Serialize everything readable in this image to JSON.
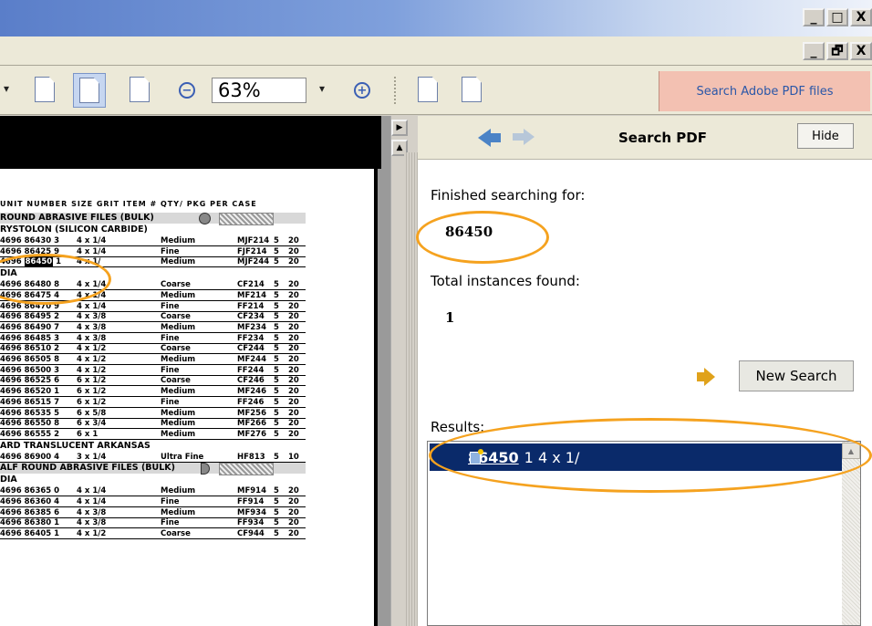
{
  "window": {
    "btn_min": "_",
    "btn_restore": "□",
    "btn_close": "X",
    "btn_min2": "_",
    "btn_restore2": "🗗",
    "btn_close2": "X"
  },
  "toolbar": {
    "zoom_out": "−",
    "zoom_value": "63%",
    "zoom_dropdown": "▾",
    "zoom_in": "+",
    "left_dropdown": "▾",
    "search_adobe_label": "Search Adobe PDF files"
  },
  "splitter": {
    "collapse_arrow": "▶",
    "scroll_up": "▲"
  },
  "search_panel": {
    "title": "Search PDF",
    "hide_label": "Hide",
    "finished_label": "Finished searching for:",
    "search_term": "86450",
    "total_label": "Total instances found:",
    "total_count": "1",
    "new_search_label": "New Search",
    "results_label": "Results:",
    "result": {
      "link": "86450",
      "rest": "1 4 x 1/"
    },
    "scroll_up": "▲"
  },
  "catalog": {
    "header": "UNIT NUMBER       SIZE                     GRIT                 ITEM #   QTY/ PKG  PER CASE",
    "sections": [
      {
        "title": "ROUND ABRASIVE FILES (BULK)",
        "shaded": true
      },
      {
        "title": "RYSTOLON (SILICON CARBIDE)",
        "shaded": false
      },
      {
        "title": "DIA",
        "shaded": false
      },
      {
        "title": "ARD TRANSLUCENT ARKANSAS",
        "shaded": false
      },
      {
        "title": "ALF ROUND ABRASIVE FILES (BULK)",
        "shaded": true
      },
      {
        "title": "DIA",
        "shaded": false
      }
    ],
    "rows_a": [
      {
        "code": "4696 86430 3",
        "size": "4 x 1/4",
        "grit": "Medium",
        "item": "MJF214",
        "q1": "5",
        "q2": "20"
      },
      {
        "code": "4696 86425 9",
        "size": "4 x 1/4",
        "grit": "Fine",
        "item": "FJF214",
        "q1": "5",
        "q2": "20"
      },
      {
        "code_pre": "4696 ",
        "code_hl": "86450",
        "code_post": " 1",
        "size": "4 x 1/",
        "grit": "Medium",
        "item": "MJF244",
        "q1": "5",
        "q2": "20"
      }
    ],
    "rows_b": [
      {
        "code": "4696 86480 8",
        "size": "4 x 1/4",
        "grit": "Coarse",
        "item": "CF214",
        "q1": "5",
        "q2": "20"
      },
      {
        "code": "4696 86475 4",
        "size": "4 x 1/4",
        "grit": "Medium",
        "item": "MF214",
        "q1": "5",
        "q2": "20"
      },
      {
        "code": "4696 86470 9",
        "size": "4 x 1/4",
        "grit": "Fine",
        "item": "FF214",
        "q1": "5",
        "q2": "20"
      },
      {
        "code": "4696 86495 2",
        "size": "4 x 3/8",
        "grit": "Coarse",
        "item": "CF234",
        "q1": "5",
        "q2": "20"
      },
      {
        "code": "4696 86490 7",
        "size": "4 x 3/8",
        "grit": "Medium",
        "item": "MF234",
        "q1": "5",
        "q2": "20"
      },
      {
        "code": "4696 86485 3",
        "size": "4 x 3/8",
        "grit": "Fine",
        "item": "FF234",
        "q1": "5",
        "q2": "20"
      },
      {
        "code": "4696 86510 2",
        "size": "4 x 1/2",
        "grit": "Coarse",
        "item": "CF244",
        "q1": "5",
        "q2": "20"
      },
      {
        "code": "4696 86505 8",
        "size": "4 x 1/2",
        "grit": "Medium",
        "item": "MF244",
        "q1": "5",
        "q2": "20"
      },
      {
        "code": "4696 86500 3",
        "size": "4 x 1/2",
        "grit": "Fine",
        "item": "FF244",
        "q1": "5",
        "q2": "20"
      },
      {
        "code": "4696 86525 6",
        "size": "6 x 1/2",
        "grit": "Coarse",
        "item": "CF246",
        "q1": "5",
        "q2": "20"
      },
      {
        "code": "4696 86520 1",
        "size": "6 x 1/2",
        "grit": "Medium",
        "item": "MF246",
        "q1": "5",
        "q2": "20"
      },
      {
        "code": "4696 86515 7",
        "size": "6 x 1/2",
        "grit": "Fine",
        "item": "FF246",
        "q1": "5",
        "q2": "20"
      },
      {
        "code": "4696 86535 5",
        "size": "6 x 5/8",
        "grit": "Medium",
        "item": "MF256",
        "q1": "5",
        "q2": "20"
      },
      {
        "code": "4696 86550 8",
        "size": "6 x 3/4",
        "grit": "Medium",
        "item": "MF266",
        "q1": "5",
        "q2": "20"
      },
      {
        "code": "4696 86555 2",
        "size": "6 x 1",
        "grit": "Medium",
        "item": "MF276",
        "q1": "5",
        "q2": "20"
      }
    ],
    "rows_c": [
      {
        "code": "4696 86900 4",
        "size": "3 x 1/4",
        "grit": "Ultra Fine",
        "item": "HF813",
        "q1": "5",
        "q2": "10"
      }
    ],
    "rows_d": [
      {
        "code": "4696 86365 0",
        "size": "4 x 1/4",
        "grit": "Medium",
        "item": "MF914",
        "q1": "5",
        "q2": "20"
      },
      {
        "code": "4696 86360 4",
        "size": "4 x 1/4",
        "grit": "Fine",
        "item": "FF914",
        "q1": "5",
        "q2": "20"
      },
      {
        "code": "4696 86385 6",
        "size": "4 x 3/8",
        "grit": "Medium",
        "item": "MF934",
        "q1": "5",
        "q2": "20"
      },
      {
        "code": "4696 86380 1",
        "size": "4 x 3/8",
        "grit": "Fine",
        "item": "FF934",
        "q1": "5",
        "q2": "20"
      },
      {
        "code": "4696 86405 1",
        "size": "4 x 1/2",
        "grit": "Coarse",
        "item": "CF944",
        "q1": "5",
        "q2": "20"
      }
    ]
  }
}
